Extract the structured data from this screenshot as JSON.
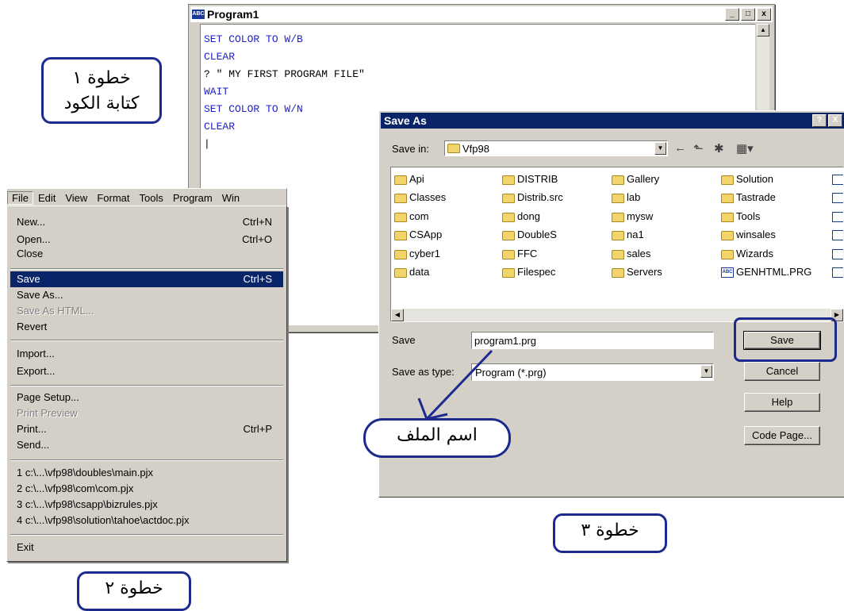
{
  "callouts": {
    "step1_line1": "خطوة ١",
    "step1_line2": "كتابة الكود",
    "step2": "خطوة ٢",
    "step3": "خطوة ٣",
    "filename_note": "اسم الملف"
  },
  "editor": {
    "icon": "ABC",
    "title": "Program1",
    "lines": [
      "SET COLOR TO W/B",
      "CLEAR",
      "? \" MY FIRST PROGRAM FILE\"",
      "WAIT",
      "SET COLOR TO W/N",
      "CLEAR",
      "|"
    ]
  },
  "window_buttons": {
    "minimize": "_",
    "maximize": "□",
    "close": "x"
  },
  "menubar": [
    "File",
    "Edit",
    "View",
    "Format",
    "Tools",
    "Program",
    "Win"
  ],
  "file_menu": {
    "new": {
      "label": "New...",
      "shortcut": "Ctrl+N"
    },
    "open": {
      "label": "Open...",
      "shortcut": "Ctrl+O"
    },
    "close": {
      "label": "Close"
    },
    "save": {
      "label": "Save",
      "shortcut": "Ctrl+S"
    },
    "save_as": {
      "label": "Save As..."
    },
    "save_as_html": {
      "label": "Save As HTML..."
    },
    "revert": {
      "label": "Revert"
    },
    "import": {
      "label": "Import..."
    },
    "export": {
      "label": "Export..."
    },
    "page_setup": {
      "label": "Page Setup..."
    },
    "print_preview": {
      "label": "Print Preview"
    },
    "print": {
      "label": "Print...",
      "shortcut": "Ctrl+P"
    },
    "send": {
      "label": "Send..."
    },
    "recent": [
      "1 c:\\...\\vfp98\\doubles\\main.pjx",
      "2 c:\\...\\vfp98\\com\\com.pjx",
      "3 c:\\...\\vfp98\\csapp\\bizrules.pjx",
      "4 c:\\...\\vfp98\\solution\\tahoe\\actdoc.pjx"
    ],
    "exit": {
      "label": "Exit"
    }
  },
  "save_as_dialog": {
    "title": "Save As",
    "help_btn": "?",
    "close_btn": "X",
    "save_in_label": "Save in:",
    "save_in_value": "Vfp98",
    "files": [
      [
        "Api",
        "Classes",
        "com",
        "CSApp",
        "cyber1",
        "data"
      ],
      [
        "DISTRIB",
        "Distrib.src",
        "dong",
        "DoubleS",
        "FFC",
        "Filespec"
      ],
      [
        "Gallery",
        "lab",
        "mysw",
        "na1",
        "sales",
        "Servers"
      ],
      [
        "Solution",
        "Tastrade",
        "Tools",
        "winsales",
        "Wizards",
        "GENHTML.PRG"
      ]
    ],
    "filename_label": "Save",
    "filename_value": "program1.prg",
    "type_label": "Save as type:",
    "type_value": "Program (*.prg)",
    "buttons": {
      "save": "Save",
      "cancel": "Cancel",
      "help": "Help",
      "code_page": "Code Page..."
    }
  },
  "colors": {
    "accent": "#1c2a8e",
    "selection": "#0a246a",
    "code_text": "#2020c8"
  }
}
